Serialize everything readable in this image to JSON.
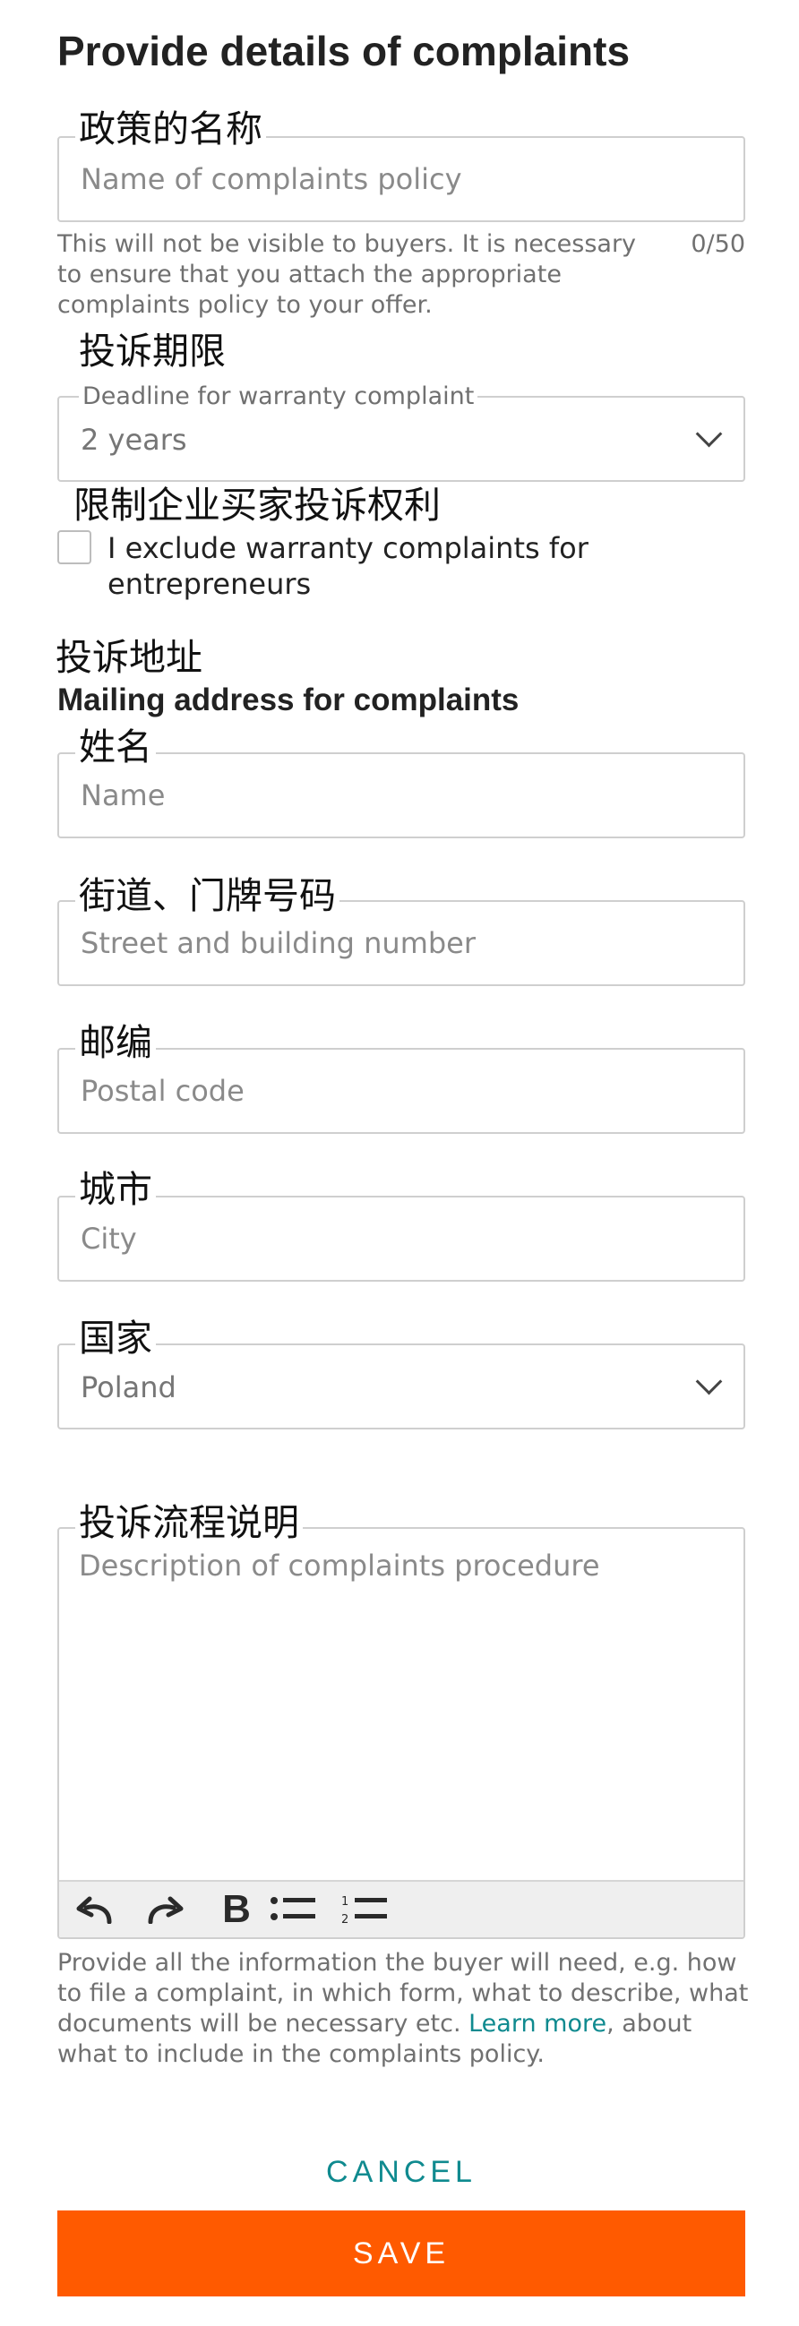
{
  "page": {
    "title": "Provide details of complaints"
  },
  "policy_name": {
    "cn_label": "政策的名称",
    "placeholder": "Name of complaints policy",
    "value": "",
    "helper": "This will not be visible to buyers. It is necessary to ensure that you attach the appropriate complaints policy to your offer.",
    "counter": "0/50"
  },
  "deadline": {
    "cn_label": "投诉期限",
    "label": "Deadline for warranty complaint",
    "value": "2 years",
    "icon": "chevron-down-icon"
  },
  "exclude_entrepreneurs": {
    "cn_label": "限制企业买家投诉权利",
    "label": "I exclude warranty complaints for entrepreneurs",
    "checked": false
  },
  "mailing_address": {
    "cn_label": "投诉地址",
    "heading": "Mailing address for complaints",
    "name": {
      "cn_label": "姓名",
      "placeholder": "Name",
      "value": ""
    },
    "street": {
      "cn_label": "街道、门牌号码",
      "placeholder": "Street and building number",
      "value": ""
    },
    "postal_code": {
      "cn_label": "邮编",
      "placeholder": "Postal code",
      "value": ""
    },
    "city": {
      "cn_label": "城市",
      "placeholder": "City",
      "value": ""
    },
    "country": {
      "cn_label": "国家",
      "value": "Poland",
      "icon": "chevron-down-icon"
    }
  },
  "procedure": {
    "cn_label": "投诉流程说明",
    "placeholder": "Description of complaints procedure",
    "value": "",
    "toolbar": {
      "undo_icon": "undo-icon",
      "redo_icon": "redo-icon",
      "bold_label": "B",
      "bullet_list_icon": "bullet-list-icon",
      "numbered_list_icon": "numbered-list-icon"
    },
    "helper_before": "Provide all the information the buyer will need, e.g. how to file a complaint, in which form, what to describe, what documents will be necessary etc. ",
    "helper_link": "Learn more",
    "helper_after": ", about what to include in the complaints policy."
  },
  "actions": {
    "cancel": "CANCEL",
    "save": "SAVE"
  },
  "colors": {
    "accent": "#0f8a8f",
    "primary_button": "#ff5a00",
    "border": "#cfcfcf",
    "placeholder": "#8a8a8a"
  }
}
